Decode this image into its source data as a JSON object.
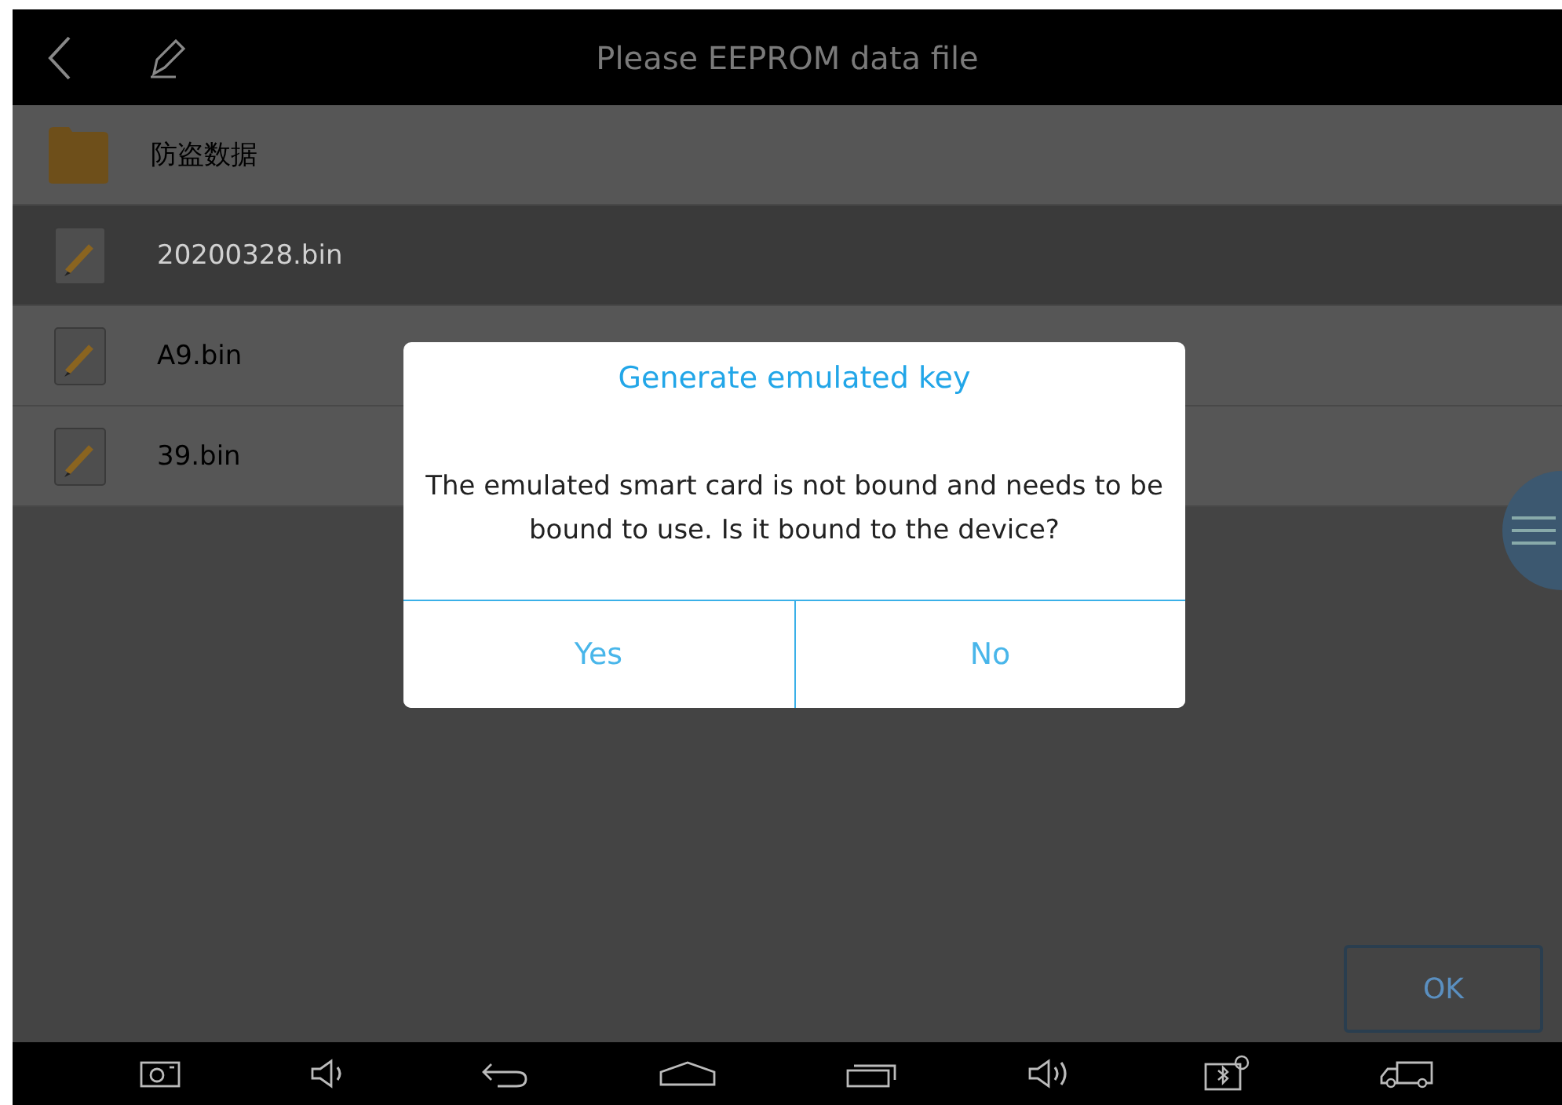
{
  "title_bar": {
    "title": "Please EEPROM data file"
  },
  "files": [
    {
      "kind": "folder",
      "name": "防盗数据",
      "selected": false
    },
    {
      "kind": "file",
      "name": "20200328.bin",
      "selected": true
    },
    {
      "kind": "file",
      "name": "A9.bin",
      "selected": false
    },
    {
      "kind": "file",
      "name": "39.bin",
      "selected": false
    }
  ],
  "ok_button": "OK",
  "dialog": {
    "title": "Generate emulated key",
    "message": "The emulated smart card  is not bound and needs to be bound to use. Is it bound to the device?",
    "buttons": [
      "Yes",
      "No"
    ]
  }
}
